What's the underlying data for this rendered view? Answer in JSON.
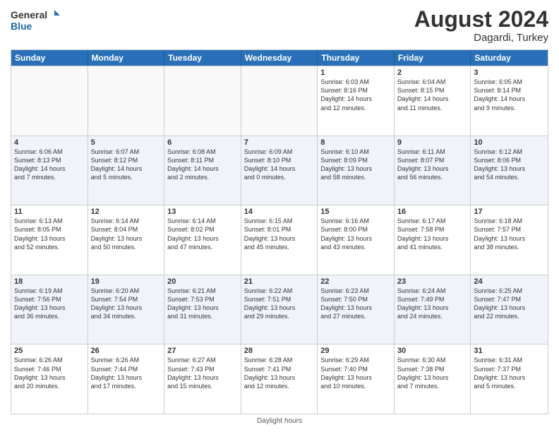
{
  "header": {
    "logo_line1": "General",
    "logo_line2": "Blue",
    "month_year": "August 2024",
    "location": "Dagardi, Turkey"
  },
  "days_of_week": [
    "Sunday",
    "Monday",
    "Tuesday",
    "Wednesday",
    "Thursday",
    "Friday",
    "Saturday"
  ],
  "footer": "Daylight hours",
  "weeks": [
    [
      {
        "day": "",
        "info": ""
      },
      {
        "day": "",
        "info": ""
      },
      {
        "day": "",
        "info": ""
      },
      {
        "day": "",
        "info": ""
      },
      {
        "day": "1",
        "info": "Sunrise: 6:03 AM\nSunset: 8:16 PM\nDaylight: 14 hours\nand 12 minutes."
      },
      {
        "day": "2",
        "info": "Sunrise: 6:04 AM\nSunset: 8:15 PM\nDaylight: 14 hours\nand 11 minutes."
      },
      {
        "day": "3",
        "info": "Sunrise: 6:05 AM\nSunset: 8:14 PM\nDaylight: 14 hours\nand 9 minutes."
      }
    ],
    [
      {
        "day": "4",
        "info": "Sunrise: 6:06 AM\nSunset: 8:13 PM\nDaylight: 14 hours\nand 7 minutes."
      },
      {
        "day": "5",
        "info": "Sunrise: 6:07 AM\nSunset: 8:12 PM\nDaylight: 14 hours\nand 5 minutes."
      },
      {
        "day": "6",
        "info": "Sunrise: 6:08 AM\nSunset: 8:11 PM\nDaylight: 14 hours\nand 2 minutes."
      },
      {
        "day": "7",
        "info": "Sunrise: 6:09 AM\nSunset: 8:10 PM\nDaylight: 14 hours\nand 0 minutes."
      },
      {
        "day": "8",
        "info": "Sunrise: 6:10 AM\nSunset: 8:09 PM\nDaylight: 13 hours\nand 58 minutes."
      },
      {
        "day": "9",
        "info": "Sunrise: 6:11 AM\nSunset: 8:07 PM\nDaylight: 13 hours\nand 56 minutes."
      },
      {
        "day": "10",
        "info": "Sunrise: 6:12 AM\nSunset: 8:06 PM\nDaylight: 13 hours\nand 54 minutes."
      }
    ],
    [
      {
        "day": "11",
        "info": "Sunrise: 6:13 AM\nSunset: 8:05 PM\nDaylight: 13 hours\nand 52 minutes."
      },
      {
        "day": "12",
        "info": "Sunrise: 6:14 AM\nSunset: 8:04 PM\nDaylight: 13 hours\nand 50 minutes."
      },
      {
        "day": "13",
        "info": "Sunrise: 6:14 AM\nSunset: 8:02 PM\nDaylight: 13 hours\nand 47 minutes."
      },
      {
        "day": "14",
        "info": "Sunrise: 6:15 AM\nSunset: 8:01 PM\nDaylight: 13 hours\nand 45 minutes."
      },
      {
        "day": "15",
        "info": "Sunrise: 6:16 AM\nSunset: 8:00 PM\nDaylight: 13 hours\nand 43 minutes."
      },
      {
        "day": "16",
        "info": "Sunrise: 6:17 AM\nSunset: 7:58 PM\nDaylight: 13 hours\nand 41 minutes."
      },
      {
        "day": "17",
        "info": "Sunrise: 6:18 AM\nSunset: 7:57 PM\nDaylight: 13 hours\nand 38 minutes."
      }
    ],
    [
      {
        "day": "18",
        "info": "Sunrise: 6:19 AM\nSunset: 7:56 PM\nDaylight: 13 hours\nand 36 minutes."
      },
      {
        "day": "19",
        "info": "Sunrise: 6:20 AM\nSunset: 7:54 PM\nDaylight: 13 hours\nand 34 minutes."
      },
      {
        "day": "20",
        "info": "Sunrise: 6:21 AM\nSunset: 7:53 PM\nDaylight: 13 hours\nand 31 minutes."
      },
      {
        "day": "21",
        "info": "Sunrise: 6:22 AM\nSunset: 7:51 PM\nDaylight: 13 hours\nand 29 minutes."
      },
      {
        "day": "22",
        "info": "Sunrise: 6:23 AM\nSunset: 7:50 PM\nDaylight: 13 hours\nand 27 minutes."
      },
      {
        "day": "23",
        "info": "Sunrise: 6:24 AM\nSunset: 7:49 PM\nDaylight: 13 hours\nand 24 minutes."
      },
      {
        "day": "24",
        "info": "Sunrise: 6:25 AM\nSunset: 7:47 PM\nDaylight: 13 hours\nand 22 minutes."
      }
    ],
    [
      {
        "day": "25",
        "info": "Sunrise: 6:26 AM\nSunset: 7:46 PM\nDaylight: 13 hours\nand 20 minutes."
      },
      {
        "day": "26",
        "info": "Sunrise: 6:26 AM\nSunset: 7:44 PM\nDaylight: 13 hours\nand 17 minutes."
      },
      {
        "day": "27",
        "info": "Sunrise: 6:27 AM\nSunset: 7:43 PM\nDaylight: 13 hours\nand 15 minutes."
      },
      {
        "day": "28",
        "info": "Sunrise: 6:28 AM\nSunset: 7:41 PM\nDaylight: 13 hours\nand 12 minutes."
      },
      {
        "day": "29",
        "info": "Sunrise: 6:29 AM\nSunset: 7:40 PM\nDaylight: 13 hours\nand 10 minutes."
      },
      {
        "day": "30",
        "info": "Sunrise: 6:30 AM\nSunset: 7:38 PM\nDaylight: 13 hours\nand 7 minutes."
      },
      {
        "day": "31",
        "info": "Sunrise: 6:31 AM\nSunset: 7:37 PM\nDaylight: 13 hours\nand 5 minutes."
      }
    ]
  ]
}
